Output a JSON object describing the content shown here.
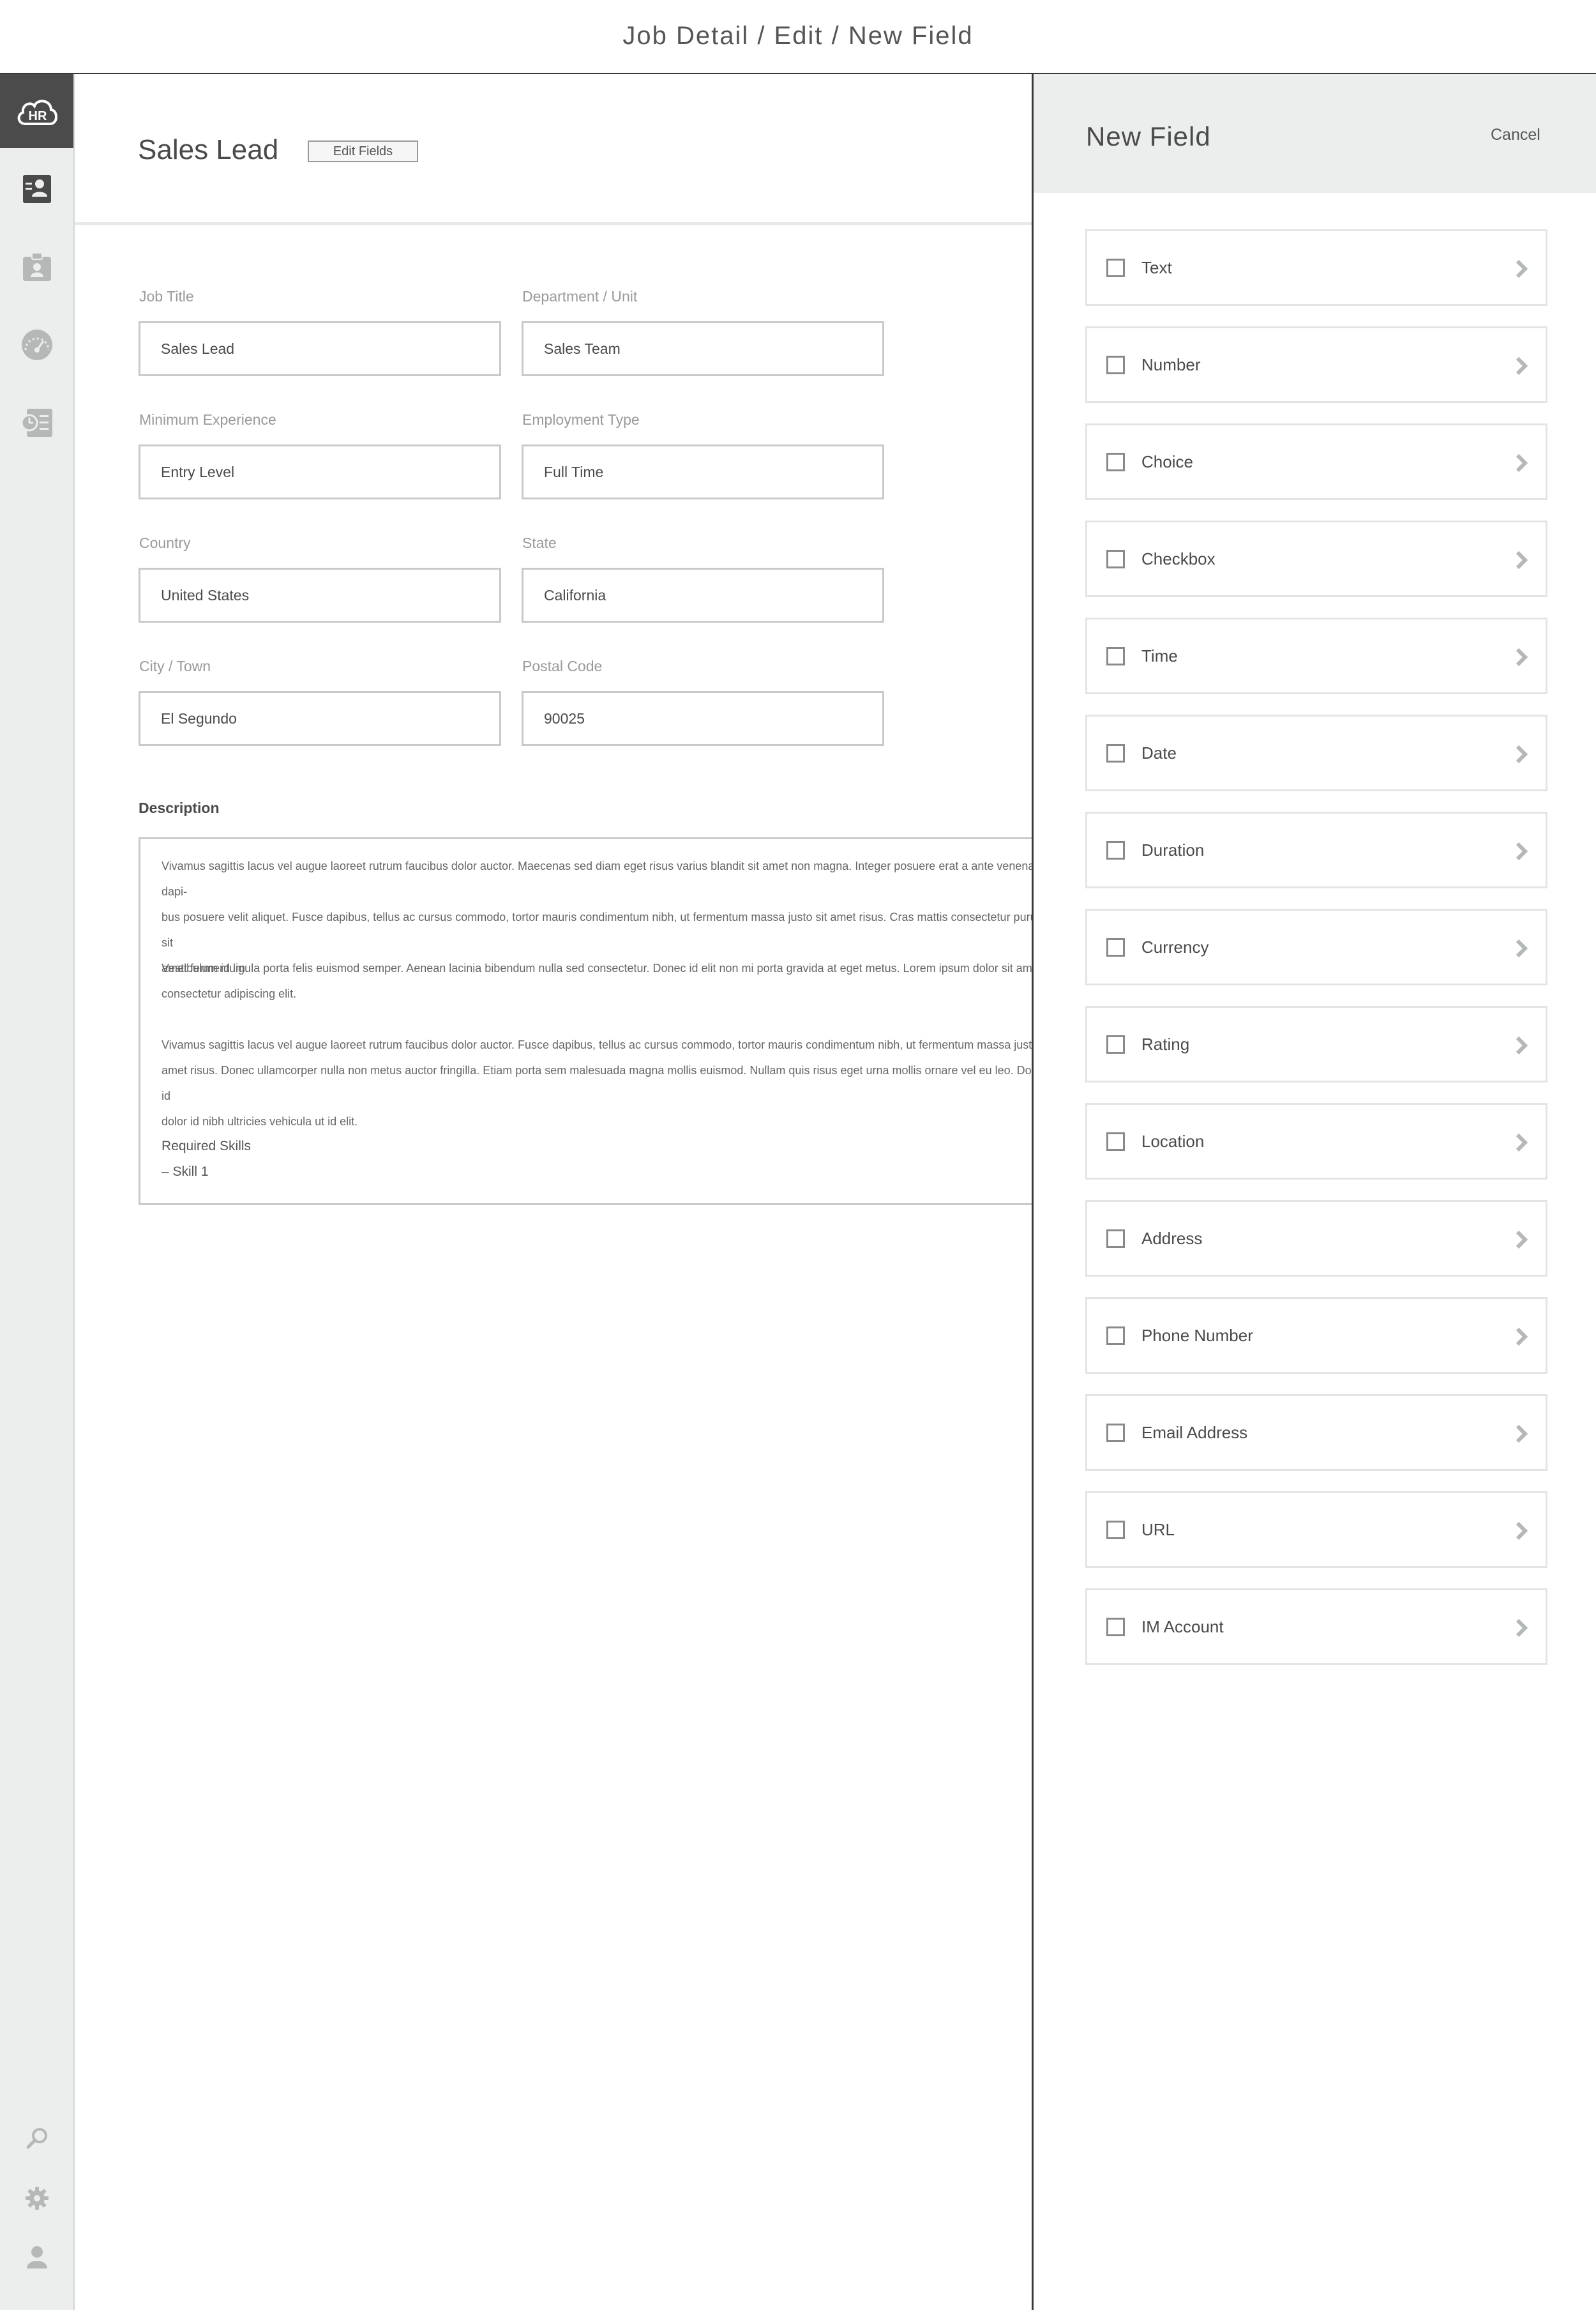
{
  "window": {
    "title": "Job Detail / Edit / New Field"
  },
  "sidebar": {
    "logo_text": "HR",
    "items": [
      {
        "icon": "candidates-icon",
        "active": true
      },
      {
        "icon": "clipboard-icon"
      },
      {
        "icon": "dashboard-gauge-icon"
      },
      {
        "icon": "timesheet-icon"
      }
    ],
    "bottom_items": [
      {
        "icon": "search-icon"
      },
      {
        "icon": "gear-icon"
      },
      {
        "icon": "user-icon"
      }
    ]
  },
  "header": {
    "title": "Sales Lead",
    "edit_button": "Edit Fields"
  },
  "form": {
    "job_title": {
      "label": "Job Title",
      "value": "Sales Lead"
    },
    "department": {
      "label": "Department / Unit",
      "value": "Sales Team"
    },
    "min_experience": {
      "label": "Minimum Experience",
      "value": "Entry Level"
    },
    "employment_type": {
      "label": "Employment Type",
      "value": "Full Time"
    },
    "country": {
      "label": "Country",
      "value": "United States"
    },
    "state": {
      "label": "State",
      "value": "California"
    },
    "city": {
      "label": "City / Town",
      "value": "El Segundo"
    },
    "postal_code": {
      "label": "Postal Code",
      "value": "90025"
    }
  },
  "description": {
    "label": "Description",
    "paragraphs": [
      "Vivamus sagittis lacus vel augue laoreet rutrum faucibus dolor auctor. Maecenas sed diam eget risus varius blandit sit amet non magna. Integer posuere erat a ante venenatis dapibus posuere velit aliquet. Fusce dapibus, tellus ac cursus commodo, tortor mauris condimentum nibh, ut fermentum massa justo sit amet risus. Cras mattis consectetur purus sit amet fermentum.",
      "Vestibulum id ligula porta felis euismod semper. Aenean lacinia bibendum nulla sed consectetur. Donec id elit non mi porta gravida at eget metus. Lorem ipsum dolor sit amet, consectetur adipiscing elit.",
      "Vivamus sagittis lacus vel augue laoreet rutrum faucibus dolor auctor. Fusce dapibus, tellus ac cursus commodo, tortor mauris condimentum nibh, ut fermentum massa justo sit amet risus. Donec ullamcorper nulla non metus auctor fringilla. Etiam porta sem malesuada magna mollis euismod. Nullam quis risus eget urna mollis ornare vel eu leo. Donec id nibh ultricies vehicula ut id elit."
    ],
    "para_lines": [
      "Vivamus sagittis lacus vel augue laoreet rutrum faucibus dolor auctor. Maecenas sed diam eget risus varius blandit sit amet non magna. Integer posuere erat a ante venenatis dapi-\nbus posuere velit aliquet. Fusce dapibus, tellus ac cursus commodo, tortor mauris condimentum nibh, ut fermentum massa justo sit amet risus. Cras mattis consectetur purus sit\namet fermentum.",
      "Vestibulum id ligula porta felis euismod semper. Aenean lacinia bibendum nulla sed consectetur. Donec id elit non mi porta gravida at eget metus. Lorem ipsum dolor sit amet,\nconsectetur adipiscing elit.",
      "Vivamus sagittis lacus vel augue laoreet rutrum faucibus dolor auctor. Fusce dapibus, tellus ac cursus commodo, tortor mauris condimentum nibh, ut fermentum massa justo sit\namet risus. Donec ullamcorper nulla non metus auctor fringilla. Etiam porta sem malesuada magna mollis euismod. Nullam quis risus eget urna mollis ornare vel eu leo. Donec id\ndolor id nibh ultricies vehicula ut id elit."
    ],
    "skills_title": "Required Skills",
    "skills": [
      "– Skill 1"
    ]
  },
  "panel": {
    "title": "New Field",
    "cancel": "Cancel",
    "options": [
      {
        "label": "Text",
        "checked": false
      },
      {
        "label": "Number",
        "checked": false
      },
      {
        "label": "Choice",
        "checked": false
      },
      {
        "label": "Checkbox",
        "checked": false
      },
      {
        "label": "Time",
        "checked": false
      },
      {
        "label": "Date",
        "checked": false
      },
      {
        "label": "Duration",
        "checked": false
      },
      {
        "label": "Currency",
        "checked": false
      },
      {
        "label": "Rating",
        "checked": false
      },
      {
        "label": "Location",
        "checked": false
      },
      {
        "label": "Address",
        "checked": false
      },
      {
        "label": "Phone Number",
        "checked": false
      },
      {
        "label": "Email Address",
        "checked": false
      },
      {
        "label": "URL",
        "checked": false
      },
      {
        "label": "IM Account",
        "checked": false
      }
    ]
  },
  "colors": {
    "sidebar_bg": "#eceeed",
    "logo_bg": "#4b4b4b",
    "icon_active": "#4a4a4a",
    "icon_inactive": "#b4b8b6",
    "border": "#c9c9c9"
  }
}
